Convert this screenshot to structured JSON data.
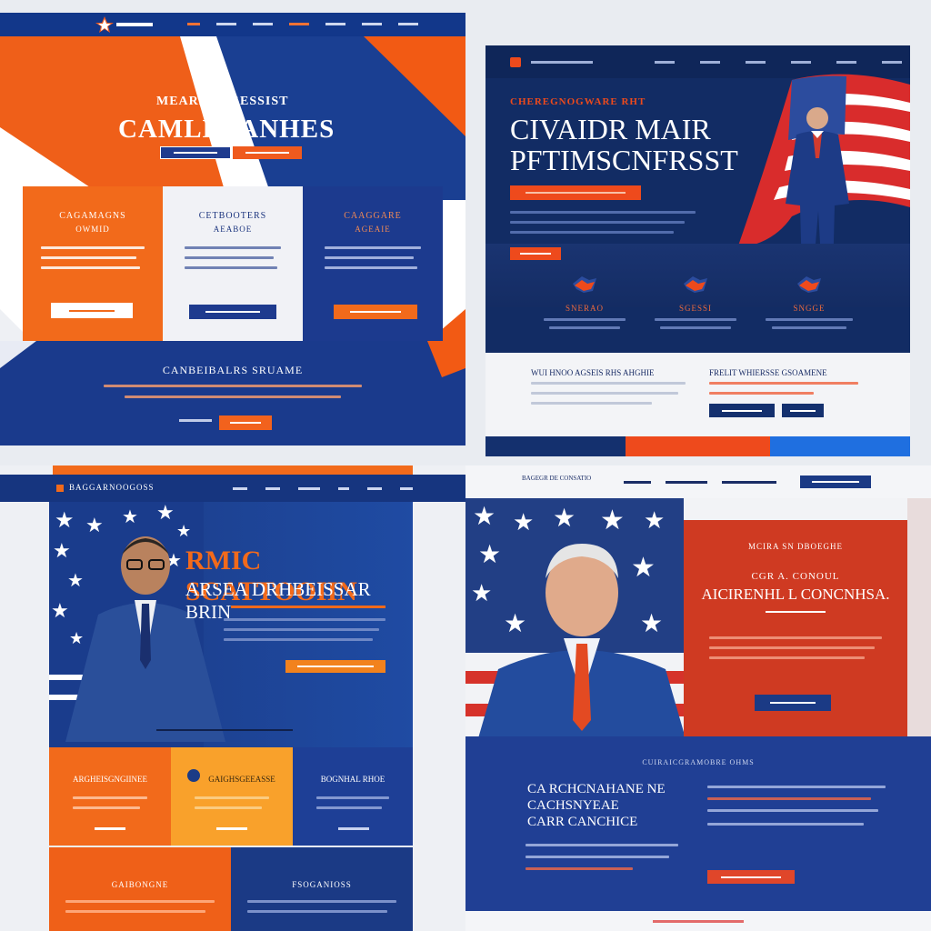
{
  "panel1": {
    "hero": {
      "eyebrow": "MEARRBOGESSIST",
      "title": "CAMLEEANHES"
    },
    "cards": [
      {
        "title": "CAGAMAGNS",
        "subtitle": "OWMID"
      },
      {
        "title": "CETBOOTERS",
        "subtitle": "AEABOE"
      },
      {
        "title": "CAAGGARE",
        "subtitle": "AGEAIE"
      }
    ],
    "band": {
      "title": "CANBEIBALRS SRUAME"
    }
  },
  "panel2": {
    "eyebrow": "CHEREGNOGWARE RHT",
    "title_line1": "CIVAIDR MAIR",
    "title_line2": "PFTIMSCNFRSST",
    "features": [
      {
        "label": "SNERAO"
      },
      {
        "label": "SGESSI"
      },
      {
        "label": "SNGGE"
      }
    ],
    "lower": {
      "left_title": "WUI HNOO AGSEIS RHS AHGHIE",
      "right_title": "FRELIT WHIERSSE GSOAMENE"
    },
    "colors": {
      "navy": "#122c64",
      "orange": "#ee4a1c",
      "blue": "#1f6fe0"
    }
  },
  "panel3": {
    "nav_title": "BAGGARNOOGOSS",
    "hero": {
      "title_line1": "RMIC SCATTOOIIN",
      "title_line2": "ARSEA DRHBEISSAR BRIN"
    },
    "cards": [
      {
        "title": "ARGHEISGNGIINEE"
      },
      {
        "title": "GAIGHSGEEASSE"
      },
      {
        "title": "BOGNHAL RHOE"
      }
    ],
    "bottom": [
      {
        "title": "GAIBONGNE"
      },
      {
        "title": "FSOGANIOSS"
      }
    ]
  },
  "panel4": {
    "nav_brand": "BAGEGR DE CONSATIO",
    "hero": {
      "eyebrow": "MCIRA SN DBOEGHE",
      "subtitle": "CGR A. CONOUL",
      "title": "AICIRENHL L CONCNHSA."
    },
    "lower": {
      "eyebrow": "CUIRAICGRAMOBRE OHMS",
      "title_line1": "CA RCHCNAHANE NE",
      "title_line2": "CACHSNYEAE",
      "title_line3": "CARR CANCHICE"
    }
  }
}
